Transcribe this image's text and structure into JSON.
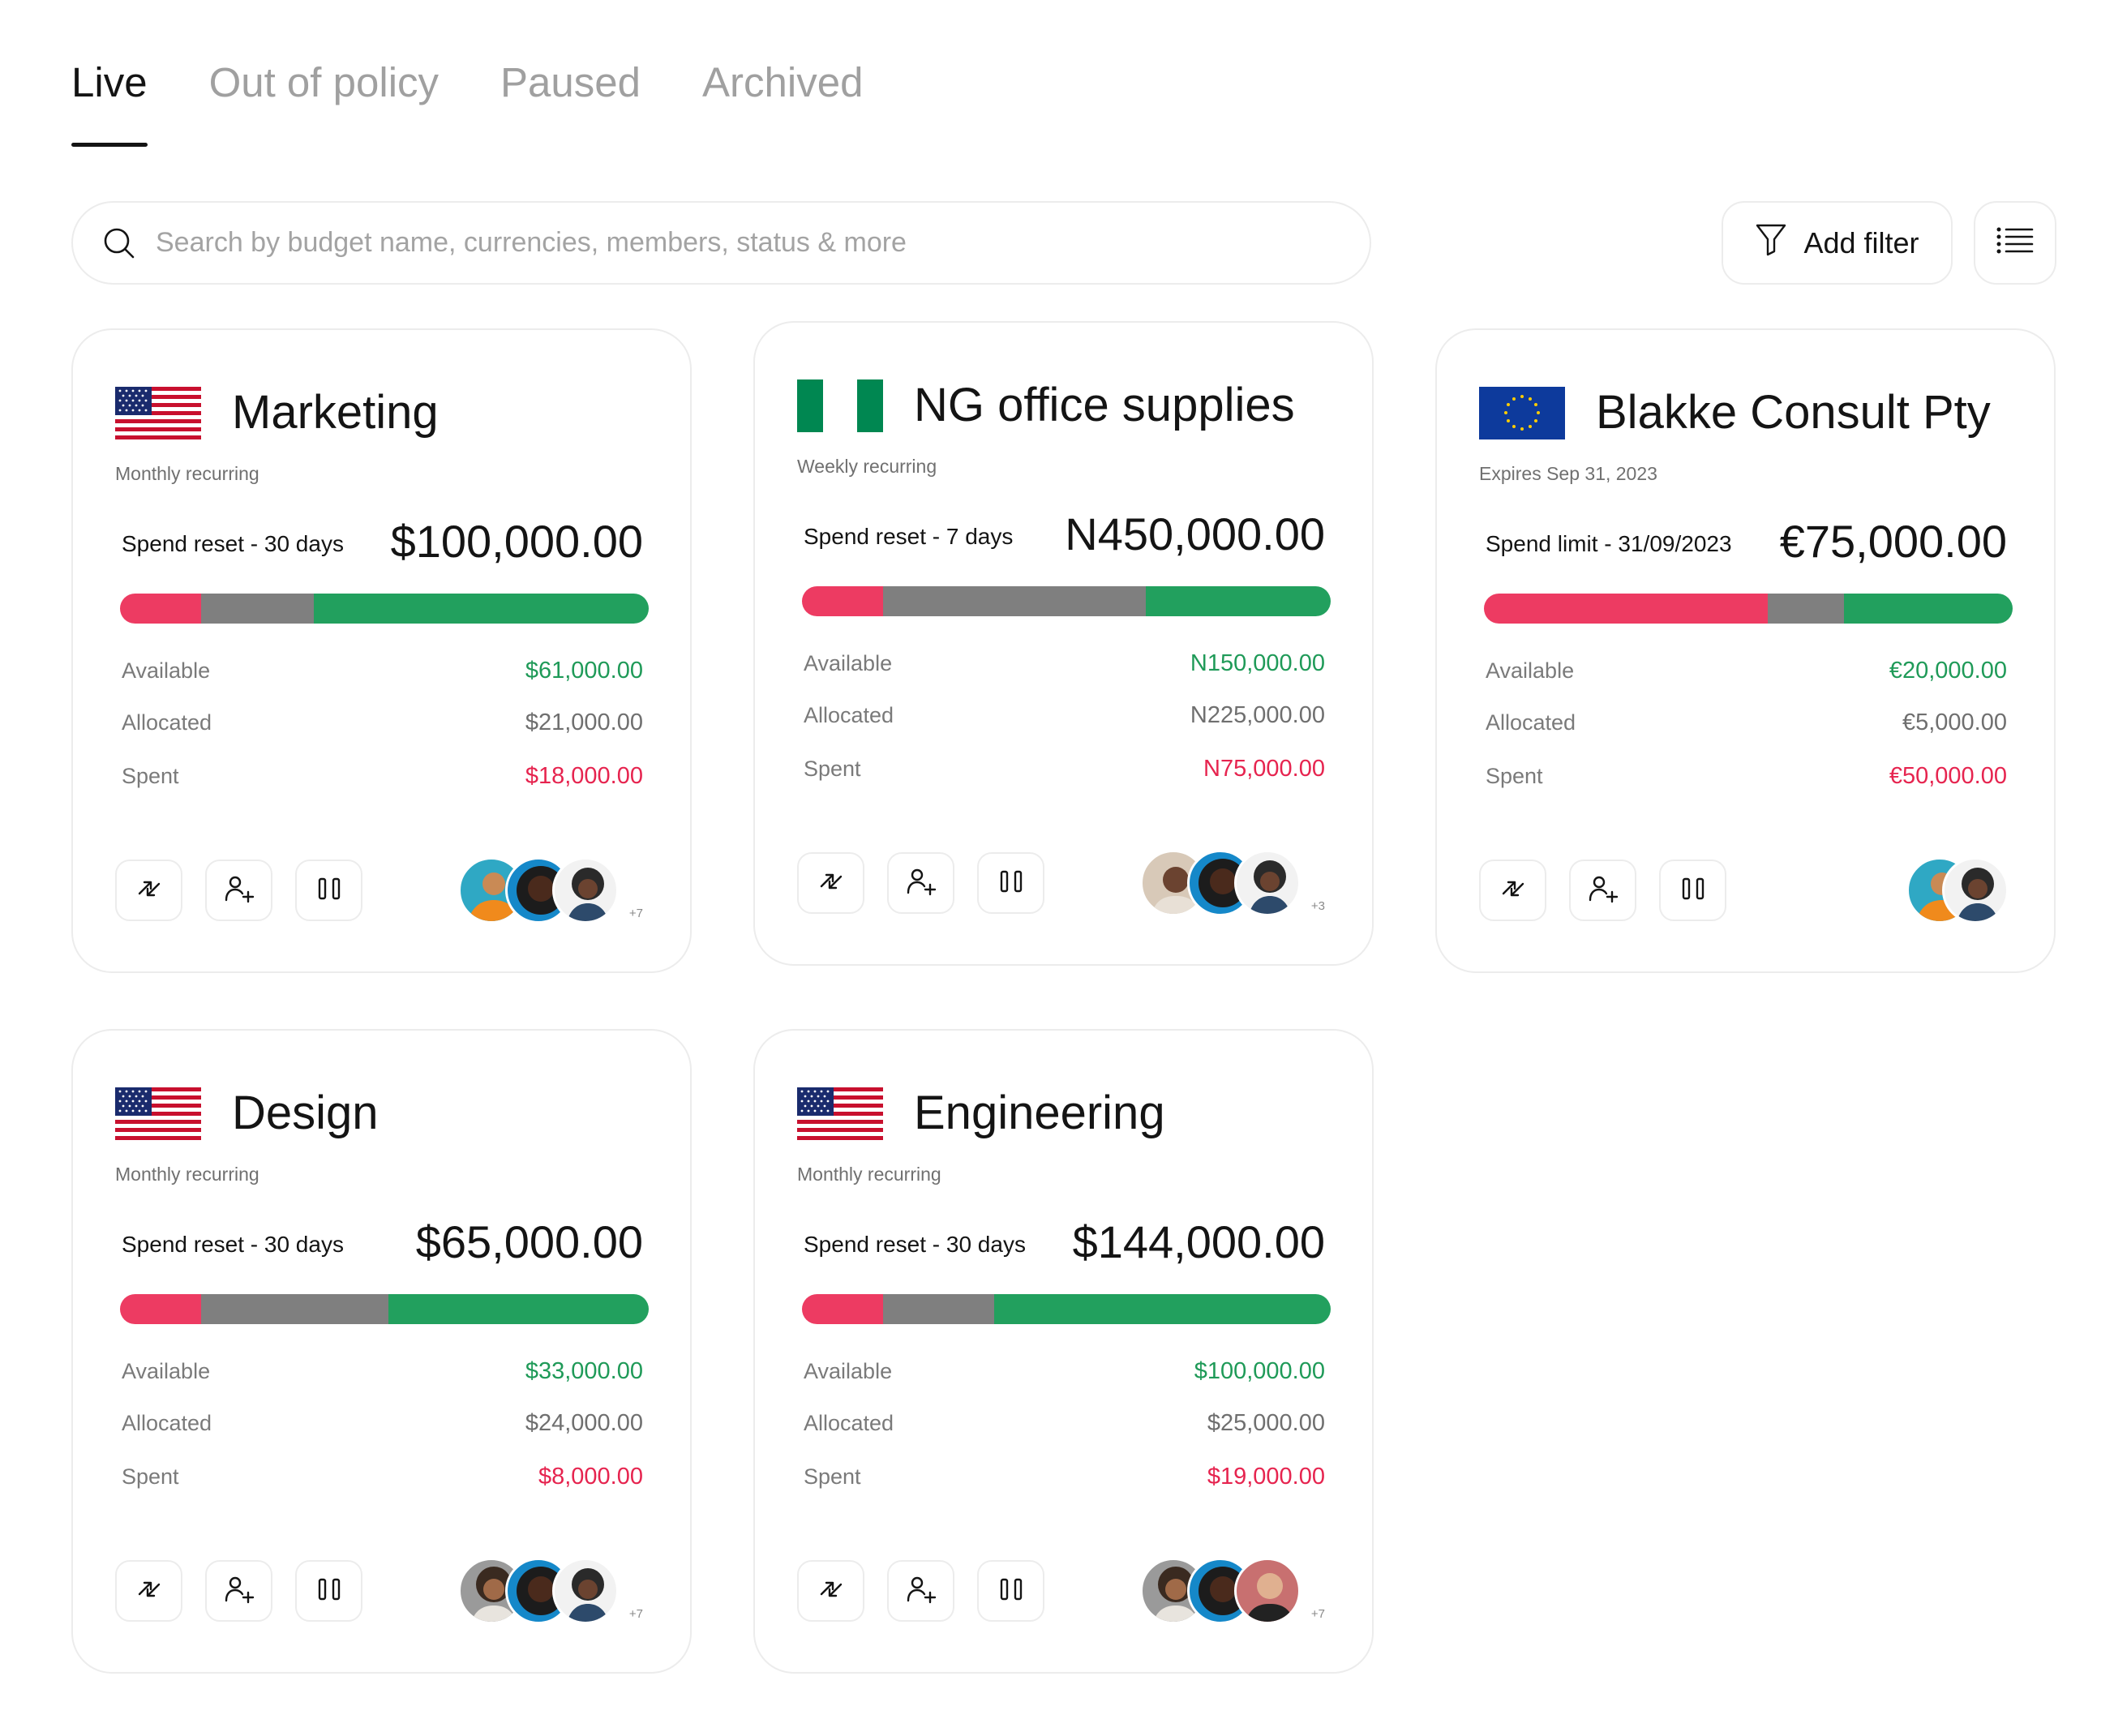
{
  "tabs": [
    {
      "label": "Live",
      "active": true
    },
    {
      "label": "Out of policy",
      "active": false
    },
    {
      "label": "Paused",
      "active": false
    },
    {
      "label": "Archived",
      "active": false
    }
  ],
  "search": {
    "placeholder": "Search by budget name, currencies, members, status & more",
    "icon": "search-icon"
  },
  "toolbar": {
    "add_filter_label": "Add filter",
    "filter_icon": "filter-icon",
    "list_view_icon": "list-icon"
  },
  "colors": {
    "spent": "#ed3b62",
    "allocated": "#7f7f7f",
    "available": "#22a05e"
  },
  "labels": {
    "available": "Available",
    "allocated": "Allocated",
    "spent": "Spent"
  },
  "cards": [
    {
      "title": "Marketing",
      "flag": "us-flag",
      "subtitle": "Monthly recurring",
      "reset_label": "Spend reset - 30 days",
      "amount": "$100,000.00",
      "bar": {
        "spent": 0.154,
        "allocated": 0.213,
        "available": 0.633
      },
      "available": "$61,000.00",
      "allocated": "$21,000.00",
      "spent": "$18,000.00",
      "members_more": "+7"
    },
    {
      "title": "NG office supplies",
      "flag": "ng-flag",
      "subtitle": "Weekly recurring",
      "reset_label": "Spend reset - 7 days",
      "amount": "N450,000.00",
      "bar": {
        "spent": 0.154,
        "allocated": 0.497,
        "available": 0.349
      },
      "available": "N150,000.00",
      "allocated": "N225,000.00",
      "spent": "N75,000.00",
      "members_more": "+3"
    },
    {
      "title": "Blakke Consult Pty",
      "flag": "eu-flag",
      "subtitle": "Expires Sep 31, 2023",
      "reset_label": "Spend limit - 31/09/2023",
      "amount": "€75,000.00",
      "bar": {
        "spent": 0.537,
        "allocated": 0.144,
        "available": 0.319
      },
      "available": "€20,000.00",
      "allocated": "€5,000.00",
      "spent": "€50,000.00",
      "members_more": ""
    },
    {
      "title": "Design",
      "flag": "us-flag",
      "subtitle": "Monthly recurring",
      "reset_label": "Spend reset - 30 days",
      "amount": "$65,000.00",
      "bar": {
        "spent": 0.154,
        "allocated": 0.354,
        "available": 0.492
      },
      "available": "$33,000.00",
      "allocated": "$24,000.00",
      "spent": "$8,000.00",
      "members_more": "+7"
    },
    {
      "title": "Engineering",
      "flag": "us-flag",
      "subtitle": "Monthly recurring",
      "reset_label": "Spend reset - 30 days",
      "amount": "$144,000.00",
      "bar": {
        "spent": 0.154,
        "allocated": 0.21,
        "available": 0.636
      },
      "available": "$100,000.00",
      "allocated": "$25,000.00",
      "spent": "$19,000.00",
      "members_more": "+7"
    }
  ]
}
